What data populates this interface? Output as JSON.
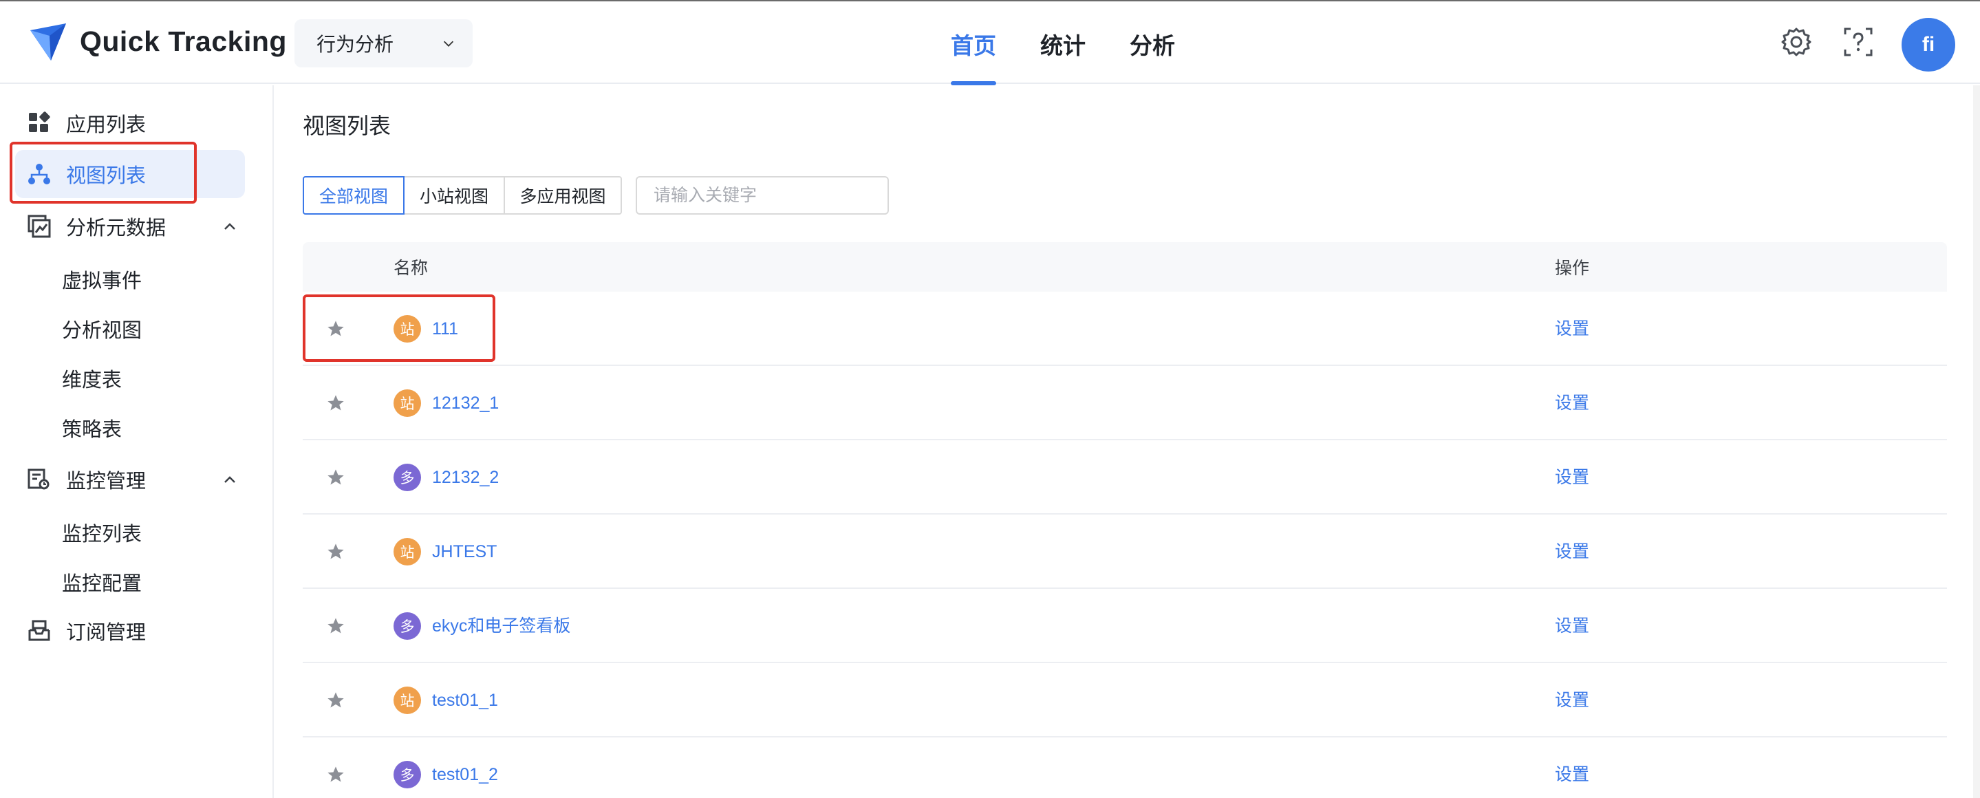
{
  "header": {
    "brand": "Quick Tracking",
    "selector_value": "行为分析",
    "nav": [
      {
        "label": "首页",
        "active": true
      },
      {
        "label": "统计",
        "active": false
      },
      {
        "label": "分析",
        "active": false
      }
    ],
    "icons": [
      "gear-icon",
      "help-icon"
    ],
    "avatar_initials": "fi"
  },
  "sidebar": {
    "items": [
      {
        "label": "应用列表",
        "icon": "apps-grid-icon"
      },
      {
        "label": "视图列表",
        "icon": "hierarchy-icon",
        "active": true
      },
      {
        "label": "分析元数据",
        "icon": "chart-icon",
        "expanded": true,
        "children": [
          "虚拟事件",
          "分析视图",
          "维度表",
          "策略表"
        ]
      },
      {
        "label": "监控管理",
        "icon": "monitor-icon",
        "expanded": true,
        "children": [
          "监控列表",
          "监控配置"
        ]
      },
      {
        "label": "订阅管理",
        "icon": "inbox-icon"
      }
    ]
  },
  "main": {
    "title": "视图列表",
    "filters": [
      {
        "label": "全部视图",
        "active": true
      },
      {
        "label": "小站视图",
        "active": false
      },
      {
        "label": "多应用视图",
        "active": false
      }
    ],
    "search_placeholder": "请输入关键字",
    "table": {
      "columns": [
        "名称",
        "操作"
      ],
      "rows": [
        {
          "badge": "站",
          "badge_color": "#f0a04b",
          "name": "111",
          "action": "设置"
        },
        {
          "badge": "站",
          "badge_color": "#f0a04b",
          "name": "12132_1",
          "action": "设置"
        },
        {
          "badge": "多",
          "badge_color": "#7b68d4",
          "name": "12132_2",
          "action": "设置"
        },
        {
          "badge": "站",
          "badge_color": "#f0a04b",
          "name": "JHTEST",
          "action": "设置"
        },
        {
          "badge": "多",
          "badge_color": "#7b68d4",
          "name": "ekyc和电子签看板",
          "action": "设置"
        },
        {
          "badge": "站",
          "badge_color": "#f0a04b",
          "name": "test01_1",
          "action": "设置"
        },
        {
          "badge": "多",
          "badge_color": "#7b68d4",
          "name": "test01_2",
          "action": "设置"
        }
      ]
    }
  },
  "colors": {
    "accent": "#3a78e8",
    "highlight_box": "#e0342b",
    "badge_site": "#f0a04b",
    "badge_multi": "#7b68d4"
  }
}
